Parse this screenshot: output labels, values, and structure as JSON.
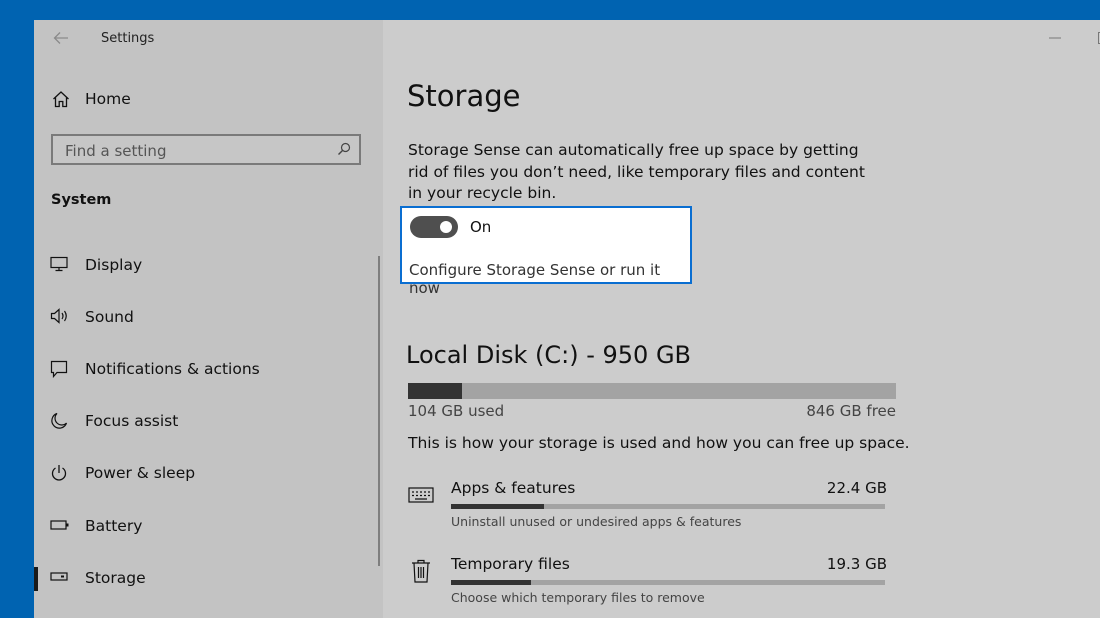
{
  "titlebar": {
    "app_title": "Settings",
    "back_icon": "back-arrow-icon",
    "minimize_icon": "minimize-icon",
    "maximize_icon": "maximize-icon"
  },
  "sidebar": {
    "home_label": "Home",
    "home_icon": "home-icon",
    "search": {
      "placeholder": "Find a setting",
      "icon": "search-icon"
    },
    "section_title": "System",
    "items": [
      {
        "label": "Display",
        "icon": "monitor-icon",
        "selected": false
      },
      {
        "label": "Sound",
        "icon": "speaker-icon",
        "selected": false
      },
      {
        "label": "Notifications & actions",
        "icon": "notification-icon",
        "selected": false
      },
      {
        "label": "Focus assist",
        "icon": "moon-icon",
        "selected": false
      },
      {
        "label": "Power & sleep",
        "icon": "power-icon",
        "selected": false
      },
      {
        "label": "Battery",
        "icon": "battery-icon",
        "selected": false
      },
      {
        "label": "Storage",
        "icon": "storage-drive-icon",
        "selected": true
      }
    ]
  },
  "main": {
    "title": "Storage",
    "description": "Storage Sense can automatically free up space by getting rid of files you don’t need, like temporary files and content in your recycle bin.",
    "storage_sense": {
      "toggle_state": "On",
      "toggle_on": true,
      "configure_link": "Configure Storage Sense or run it now"
    },
    "disk": {
      "title": "Local Disk (C:) - 950 GB",
      "used_label": "104 GB used",
      "free_label": "846 GB free",
      "used_fraction": 0.11
    },
    "usage_description": "This is how your storage is used and how you can free up space.",
    "categories": [
      {
        "name": "Apps & features",
        "size": "22.4 GB",
        "subtitle": "Uninstall unused or undesired apps & features",
        "icon": "keyboard-icon",
        "fraction": 0.215
      },
      {
        "name": "Temporary files",
        "size": "19.3 GB",
        "subtitle": "Choose which temporary files to remove",
        "icon": "trash-icon",
        "fraction": 0.185
      }
    ]
  },
  "colors": {
    "desktop": "#0063b1",
    "sidebar": "#c3c3c3",
    "main": "#cccccc",
    "accent": "#0a6ed1",
    "bar_fill": "#333333",
    "bar_track": "#a3a3a3"
  }
}
